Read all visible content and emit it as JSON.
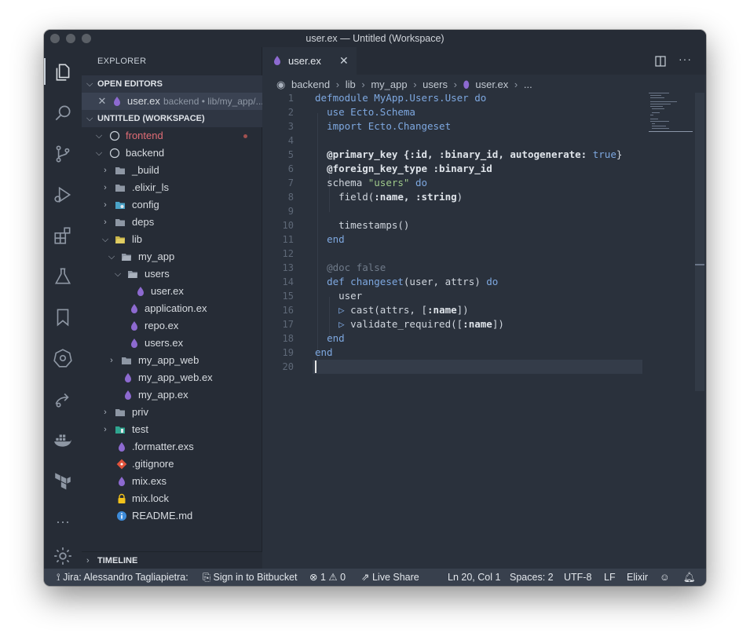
{
  "window": {
    "title": "user.ex — Untitled (Workspace)"
  },
  "explorer": {
    "title": "EXPLORER",
    "open_editors": {
      "header": "OPEN EDITORS",
      "items": [
        {
          "name": "user.ex",
          "path": "backend • lib/my_app/..."
        }
      ]
    },
    "workspace": {
      "header": "UNTITLED (WORKSPACE)",
      "tree": [
        {
          "label": "frontend"
        },
        {
          "label": "backend"
        },
        {
          "label": "_build"
        },
        {
          "label": ".elixir_ls"
        },
        {
          "label": "config"
        },
        {
          "label": "deps"
        },
        {
          "label": "lib"
        },
        {
          "label": "my_app"
        },
        {
          "label": "users"
        },
        {
          "label": "user.ex"
        },
        {
          "label": "application.ex"
        },
        {
          "label": "repo.ex"
        },
        {
          "label": "users.ex"
        },
        {
          "label": "my_app_web"
        },
        {
          "label": "my_app_web.ex"
        },
        {
          "label": "my_app.ex"
        },
        {
          "label": "priv"
        },
        {
          "label": "test"
        },
        {
          "label": ".formatter.exs"
        },
        {
          "label": ".gitignore"
        },
        {
          "label": "mix.exs"
        },
        {
          "label": "mix.lock"
        },
        {
          "label": "README.md"
        }
      ]
    },
    "timeline": "TIMELINE"
  },
  "editor": {
    "tab": {
      "label": "user.ex"
    },
    "breadcrumb": [
      "backend",
      "lib",
      "my_app",
      "users",
      "user.ex",
      "..."
    ],
    "lines": [
      {
        "n": "1"
      },
      {
        "n": "2"
      },
      {
        "n": "3"
      },
      {
        "n": "4"
      },
      {
        "n": "5"
      },
      {
        "n": "6"
      },
      {
        "n": "7"
      },
      {
        "n": "8"
      },
      {
        "n": "9"
      },
      {
        "n": "10"
      },
      {
        "n": "11"
      },
      {
        "n": "12"
      },
      {
        "n": "13"
      },
      {
        "n": "14"
      },
      {
        "n": "15"
      },
      {
        "n": "16"
      },
      {
        "n": "17"
      },
      {
        "n": "18"
      },
      {
        "n": "19"
      },
      {
        "n": "20"
      }
    ],
    "code": {
      "l1_kw": "defmodule",
      "l1_mod": "MyApp.Users.User",
      "l1_do": "do",
      "l2_kw": "use",
      "l2_mod": "Ecto.Schema",
      "l3_kw": "import",
      "l3_mod": "Ecto.Changeset",
      "l5_attr": "@primary_key",
      "l5_a": "{:id, :binary_id,",
      "l5_b": "autogenerate:",
      "l5_c": "true",
      "l5_d": "}",
      "l6_attr": "@foreign_key_type",
      "l6_a": ":binary_id",
      "l7_a": "schema",
      "l7_str": "\"users\"",
      "l7_do": "do",
      "l8_a": "field(",
      "l8_b": ":name, :string",
      "l8_c": ")",
      "l10_a": "timestamps()",
      "l11_end": "end",
      "l13_cm": "@doc false",
      "l14_kw": "def",
      "l14_fn": "changeset",
      "l14_args": "(user, attrs)",
      "l14_do": "do",
      "l15_a": "user",
      "l16_pipe": "▷",
      "l16_a": "cast(attrs, [",
      "l16_b": ":name",
      "l16_c": "])",
      "l17_pipe": "▷",
      "l17_a": "validate_required([",
      "l17_b": ":name",
      "l17_c": "])",
      "l18_end": "end",
      "l19_end": "end"
    }
  },
  "statusbar": {
    "jira": "Jira: Alessandro Tagliapietra:",
    "bitbucket": "Sign in to Bitbucket",
    "errors": "1",
    "warnings": "0",
    "liveshare": "Live Share",
    "position": "Ln 20, Col 1",
    "spaces": "Spaces: 2",
    "encoding": "UTF-8",
    "eol": "LF",
    "language": "Elixir"
  },
  "colors": {
    "background": "#262c36",
    "editor": "#2a313c",
    "accent": "#7ea8e0",
    "elixir_purple": "#8d6ad0",
    "git_modified": "#e06c75"
  }
}
